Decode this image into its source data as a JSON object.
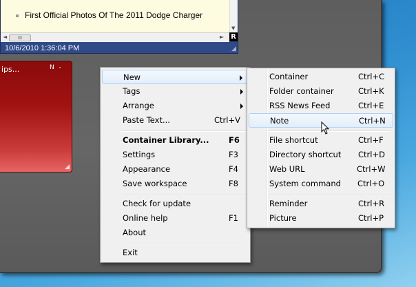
{
  "note": {
    "item_text": "First Official Photos Of The 2011 Dodge Charger",
    "timestamp": "10/6/2010 1:36:04 PM",
    "scroll_thumb": "III",
    "badge": "R"
  },
  "red_note": {
    "title": "ips...",
    "controls": "N -"
  },
  "main_menu": {
    "items": [
      {
        "label": "New",
        "shortcut": "",
        "submenu": true,
        "highlighted": true
      },
      {
        "label": "Tags",
        "shortcut": "",
        "submenu": true
      },
      {
        "label": "Arrange",
        "shortcut": "",
        "submenu": true
      },
      {
        "label": "Paste Text...",
        "shortcut": "Ctrl+V"
      },
      {
        "label": "Container Library...",
        "shortcut": "F6",
        "bold": true
      },
      {
        "label": "Settings",
        "shortcut": "F3"
      },
      {
        "label": "Appearance",
        "shortcut": "F4"
      },
      {
        "label": "Save workspace",
        "shortcut": "F8"
      },
      {
        "label": "Check for update",
        "shortcut": ""
      },
      {
        "label": "Online help",
        "shortcut": "F1"
      },
      {
        "label": "About",
        "shortcut": ""
      },
      {
        "label": "Exit",
        "shortcut": ""
      }
    ]
  },
  "sub_menu": {
    "items": [
      {
        "label": "Container",
        "shortcut": "Ctrl+C"
      },
      {
        "label": "Folder container",
        "shortcut": "Ctrl+K"
      },
      {
        "label": "RSS News Feed",
        "shortcut": "Ctrl+E"
      },
      {
        "label": "Note",
        "shortcut": "Ctrl+N",
        "highlighted": true
      },
      {
        "label": "File shortcut",
        "shortcut": "Ctrl+F"
      },
      {
        "label": "Directory shortcut",
        "shortcut": "Ctrl+D"
      },
      {
        "label": "Web URL",
        "shortcut": "Ctrl+W"
      },
      {
        "label": "System command",
        "shortcut": "Ctrl+O"
      },
      {
        "label": "Reminder",
        "shortcut": "Ctrl+R"
      },
      {
        "label": "Picture",
        "shortcut": "Ctrl+P"
      }
    ]
  },
  "icons": {
    "submenu": "chevron-right-icon",
    "cursor": "mouse-pointer-icon"
  }
}
